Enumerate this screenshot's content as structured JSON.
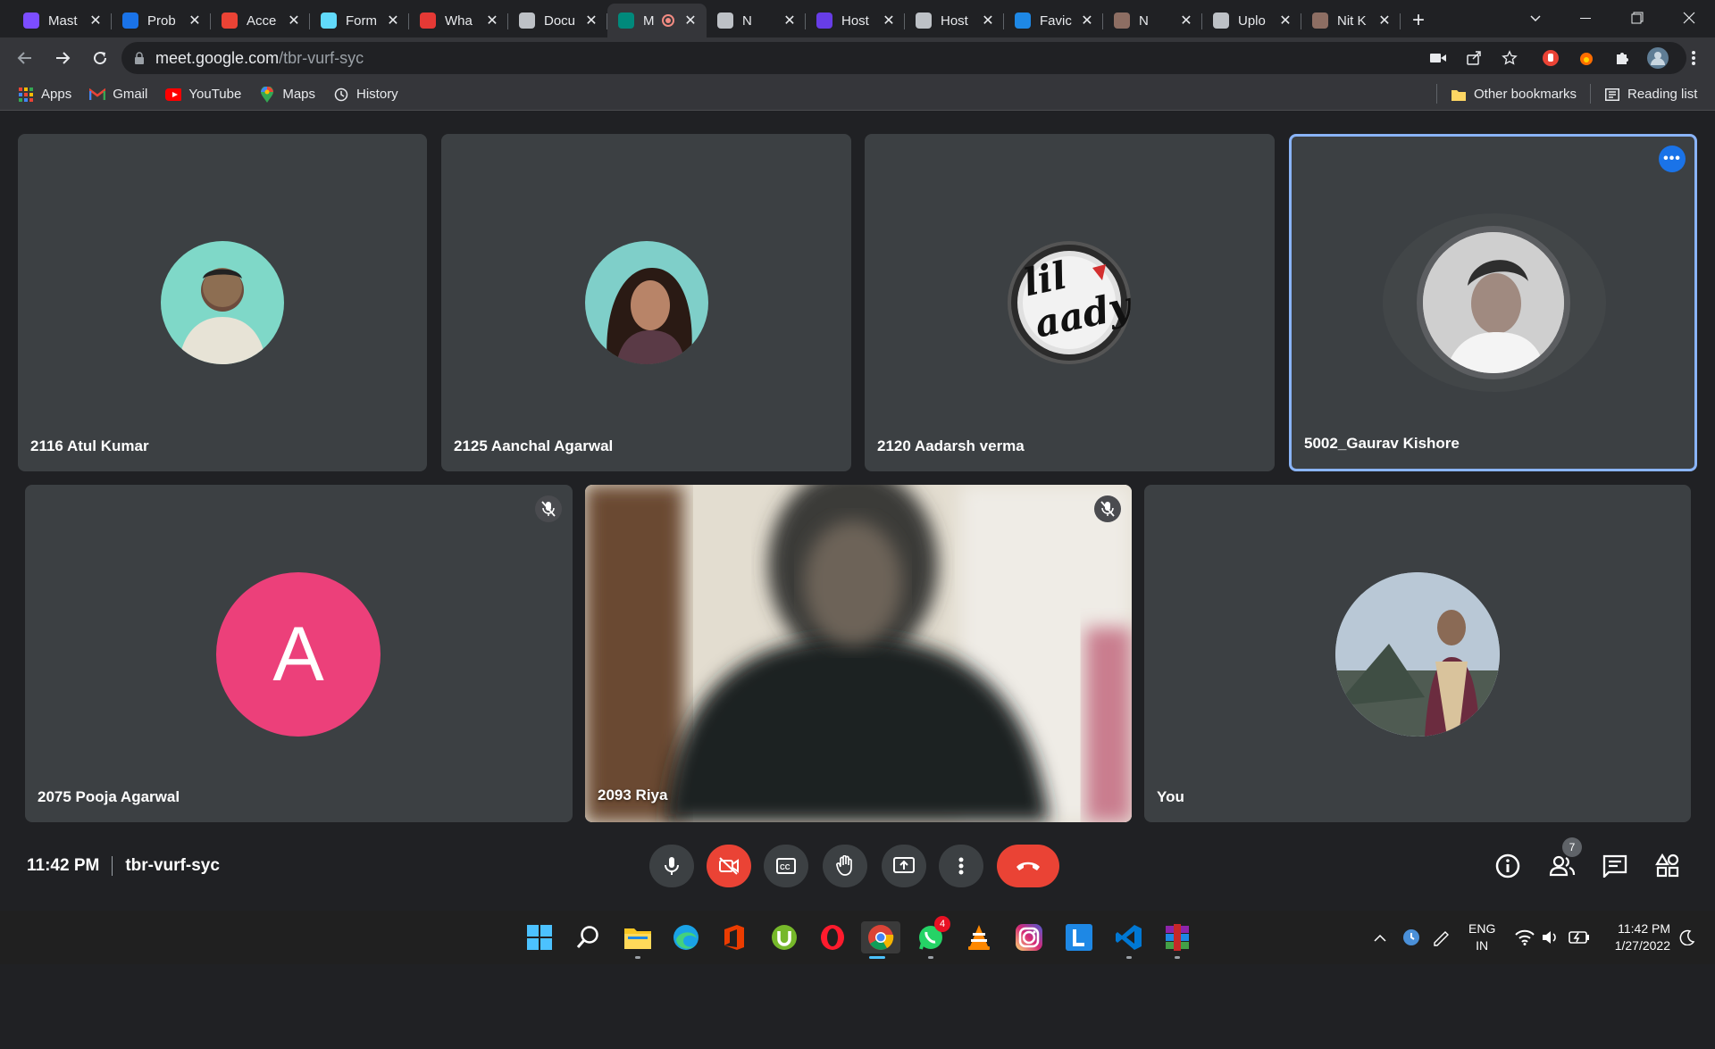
{
  "browser": {
    "tabs": [
      {
        "title": "Mast",
        "icon": "u-icon",
        "color": "#7c4dff",
        "active": false
      },
      {
        "title": "Prob",
        "icon": "bars-icon",
        "color": "#1a73e8",
        "active": false
      },
      {
        "title": "Acce",
        "icon": "gmail-icon",
        "color": "#ea4335",
        "active": false
      },
      {
        "title": "Form",
        "icon": "react-icon",
        "color": "#61dafb",
        "active": false
      },
      {
        "title": "Wha",
        "icon": "d-icon",
        "color": "#e53935",
        "active": false
      },
      {
        "title": "Docu",
        "icon": "globe-icon",
        "color": "#bdc1c6",
        "active": false
      },
      {
        "title": "M",
        "icon": "meet-icon",
        "color": "#00897b",
        "active": true
      },
      {
        "title": "N",
        "icon": "globe-icon",
        "color": "#bdc1c6",
        "active": false
      },
      {
        "title": "Host",
        "icon": "h-icon",
        "color": "#673de6",
        "active": false
      },
      {
        "title": "Host",
        "icon": "globe-icon",
        "color": "#bdc1c6",
        "active": false
      },
      {
        "title": "Favic",
        "icon": "f-icon",
        "color": "#1e88e5",
        "active": false
      },
      {
        "title": "N",
        "icon": "skull-icon",
        "color": "#8d6e63",
        "active": false
      },
      {
        "title": "Uplo",
        "icon": "layers-icon",
        "color": "#bdc1c6",
        "active": false
      },
      {
        "title": "Nit K",
        "icon": "skull-icon",
        "color": "#8d6e63",
        "active": false
      }
    ],
    "url_host": "meet.google.com",
    "url_path": "/tbr-vurf-syc",
    "bookmarks": [
      {
        "label": "Apps",
        "icon": "apps-grid-icon"
      },
      {
        "label": "Gmail",
        "icon": "gmail-icon"
      },
      {
        "label": "YouTube",
        "icon": "youtube-icon"
      },
      {
        "label": "Maps",
        "icon": "maps-pin-icon"
      },
      {
        "label": "History",
        "icon": "history-icon"
      }
    ],
    "other_bookmarks": "Other bookmarks",
    "reading_list": "Reading list"
  },
  "meeting": {
    "participants": [
      {
        "name": "2116 Atul Kumar",
        "avatar": "photo",
        "muted": false,
        "speaking": false
      },
      {
        "name": "2125 Aanchal Agarwal",
        "avatar": "photo",
        "muted": false,
        "speaking": false
      },
      {
        "name": "2120 Aadarsh verma",
        "avatar": "logo",
        "muted": false,
        "speaking": false
      },
      {
        "name": "5002_Gaurav Kishore",
        "avatar": "photo",
        "muted": false,
        "speaking": true
      },
      {
        "name": "2075 Pooja Agarwal",
        "avatar": "letter",
        "letter": "A",
        "color": "#ec407a",
        "muted": true
      },
      {
        "name": "2093 Riya",
        "avatar": "video",
        "muted": true
      },
      {
        "name": "You",
        "avatar": "photo",
        "muted": false
      }
    ],
    "logo_text_1": "lil",
    "logo_text_2": "aady",
    "time": "11:42 PM",
    "code": "tbr-vurf-syc",
    "participant_count": "7"
  },
  "taskbar": {
    "apps": [
      "windows-start-icon",
      "search-icon",
      "file-explorer-icon",
      "edge-icon",
      "office-icon",
      "utorrent-icon",
      "opera-icon",
      "chrome-icon",
      "whatsapp-icon",
      "vlc-icon",
      "instagram-icon",
      "l-app-icon",
      "vscode-icon",
      "winrar-icon"
    ],
    "whatsapp_badge": "4",
    "lang_top": "ENG",
    "lang_bottom": "IN",
    "clock_time": "11:42 PM",
    "clock_date": "1/27/2022"
  }
}
